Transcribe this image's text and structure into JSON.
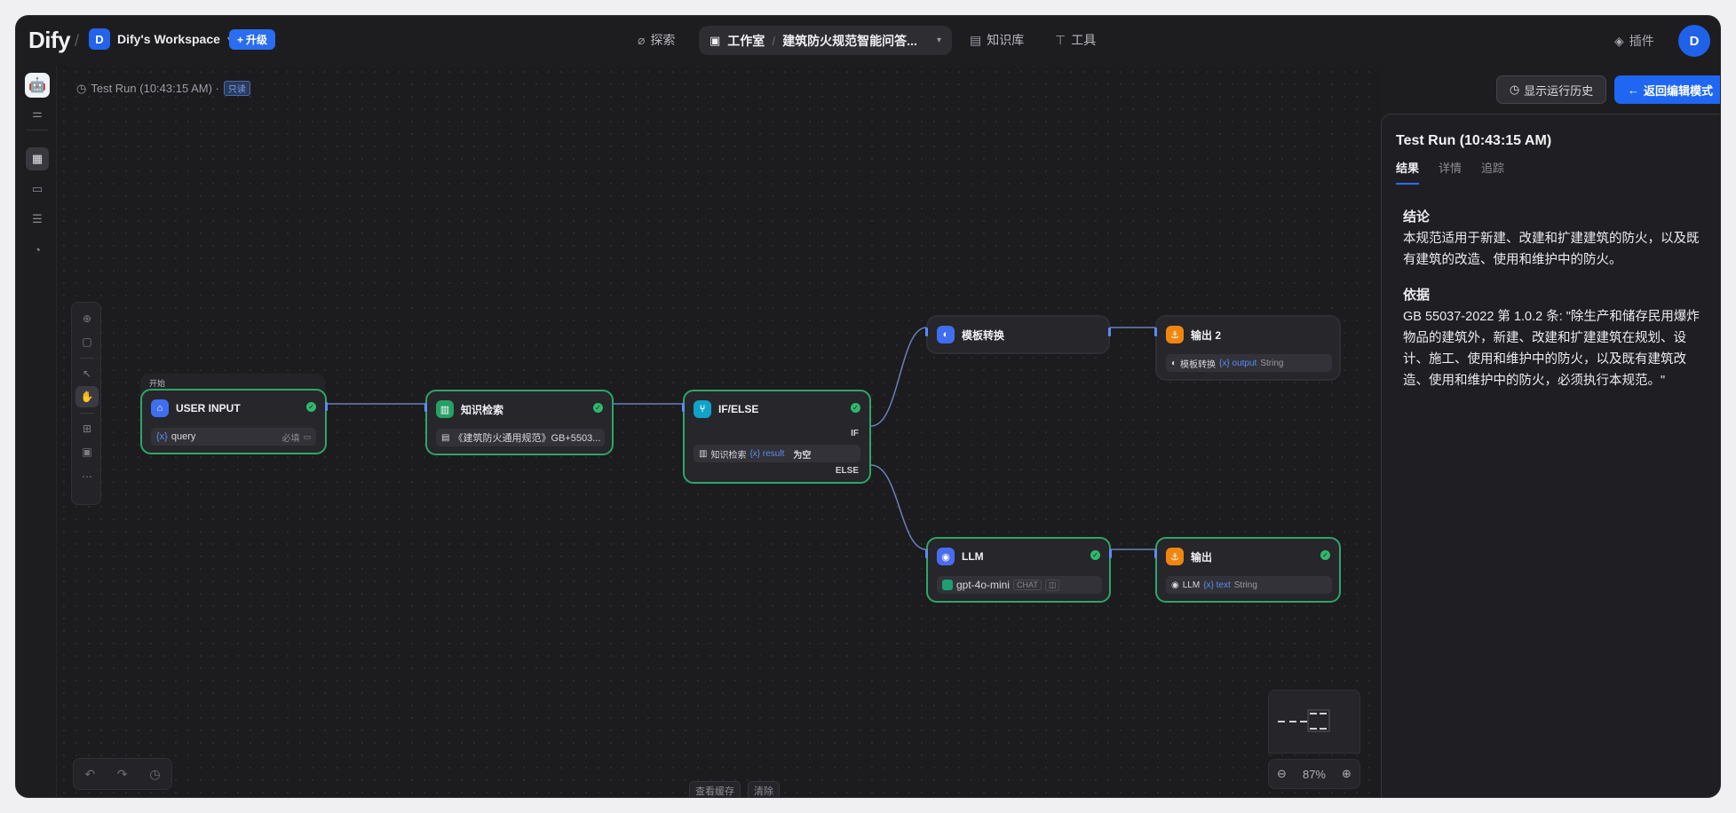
{
  "topbar": {
    "logo": "Dify",
    "workspace_initial": "D",
    "workspace_name": "Dify's Workspace",
    "upgrade_label": "升级",
    "nav": {
      "explore": "探索",
      "studio": "工作室",
      "app_name": "建筑防火规范智能问答...",
      "knowledge": "知识库",
      "tools": "工具",
      "plugins": "插件"
    },
    "user_initial": "D"
  },
  "canvas": {
    "run_label": "Test Run (10:43:15 AM) ·",
    "readonly_badge": "只读",
    "history_button": "显示运行历史",
    "back_button": "返回编辑模式",
    "view_cache": "查看缓存",
    "clear": "清除",
    "zoom": "87%"
  },
  "nodes": {
    "start_tab": "开始",
    "user_input": {
      "title": "USER INPUT",
      "field_var": "{x}",
      "field_name": "query",
      "field_required": "必填"
    },
    "knowledge": {
      "title": "知识检索",
      "dataset": "《建筑防火通用规范》GB+5503..."
    },
    "ifelse": {
      "title": "IF/ELSE",
      "if_label": "IF",
      "cond_src": "知识检索",
      "cond_var": "{x} result",
      "cond_op": "为空",
      "else_label": "ELSE"
    },
    "template": {
      "title": "模板转换"
    },
    "output2": {
      "title": "输出 2",
      "src": "模板转换",
      "var": "{x} output",
      "type": "String"
    },
    "llm": {
      "title": "LLM",
      "model": "gpt-4o-mini",
      "mode": "CHAT"
    },
    "output": {
      "title": "输出",
      "src": "LLM",
      "var": "{x} text",
      "type": "String"
    }
  },
  "panel": {
    "title": "Test Run (10:43:15 AM)",
    "tabs": [
      "结果",
      "详情",
      "追踪"
    ],
    "conclusion_heading": "结论",
    "conclusion_text": "本规范适用于新建、改建和扩建建筑的防火，以及既有建筑的改造、使用和维护中的防火。",
    "basis_heading": "依据",
    "basis_text": "GB 55037-2022 第 1.0.2 条: \"除生产和储存民用爆炸物品的建筑外，新建、改建和扩建建筑在规划、设计、施工、使用和维护中的防火，以及既有建筑改造、使用和维护中的防火，必须执行本规范。\""
  },
  "colors": {
    "accent": "#1f66f2",
    "success": "#2fb86c",
    "background": "#1d1d20"
  }
}
